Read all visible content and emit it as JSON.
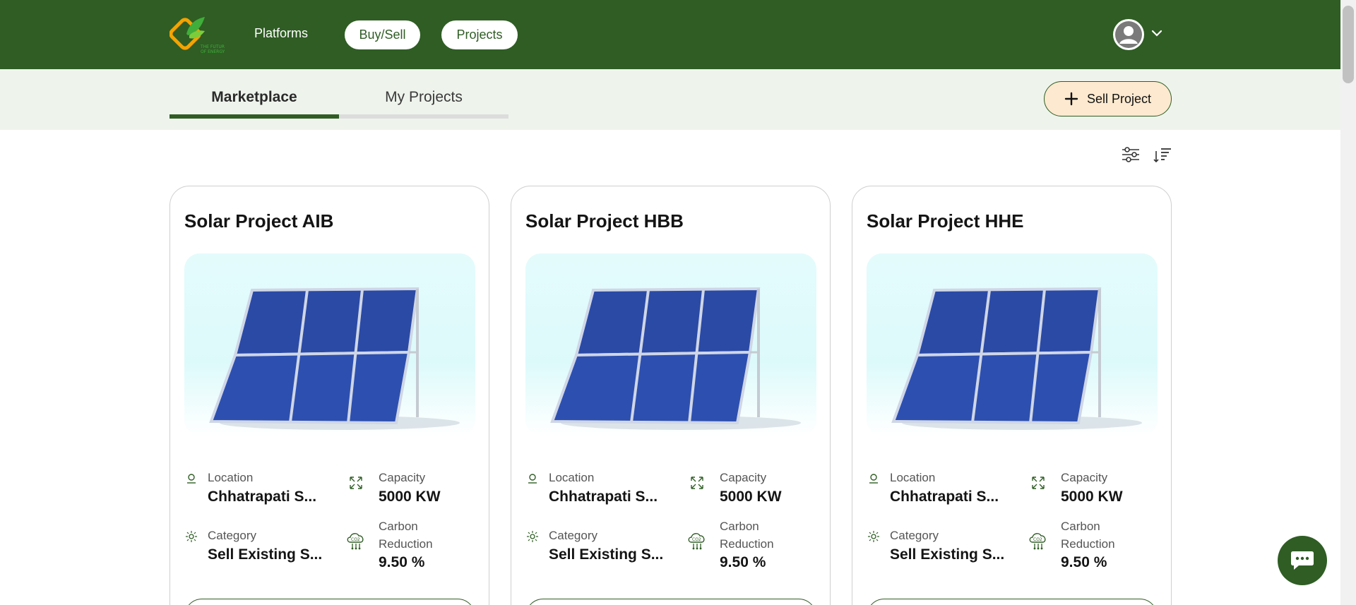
{
  "header": {
    "nav_platforms": "Platforms",
    "nav_buysell": "Buy/Sell",
    "nav_projects": "Projects",
    "brand_color": "#2f5d24"
  },
  "tabs": {
    "marketplace": "Marketplace",
    "my_projects": "My Projects",
    "active": "Marketplace"
  },
  "actions": {
    "sell_project": "Sell Project"
  },
  "labels": {
    "location": "Location",
    "capacity": "Capacity",
    "category": "Category",
    "carbon_line1": "Carbon",
    "carbon_line2": "Reduction"
  },
  "projects": [
    {
      "title": "Solar Project AIB",
      "location": "Chhatrapati S...",
      "capacity": "5000 KW",
      "category": "Sell Existing S...",
      "carbon_reduction": "9.50 %"
    },
    {
      "title": "Solar Project HBB",
      "location": "Chhatrapati S...",
      "capacity": "5000 KW",
      "category": "Sell Existing S...",
      "carbon_reduction": "9.50 %"
    },
    {
      "title": "Solar Project HHE",
      "location": "Chhatrapati S...",
      "capacity": "5000 KW",
      "category": "Sell Existing S...",
      "carbon_reduction": "9.50 %"
    }
  ],
  "icons": [
    "logo",
    "user-avatar-icon",
    "chevron-down-icon",
    "plus-icon",
    "filter-icon",
    "sort-icon",
    "location-pin-icon",
    "capacity-expand-icon",
    "category-sun-icon",
    "co2-cloud-icon",
    "chat-icon"
  ]
}
